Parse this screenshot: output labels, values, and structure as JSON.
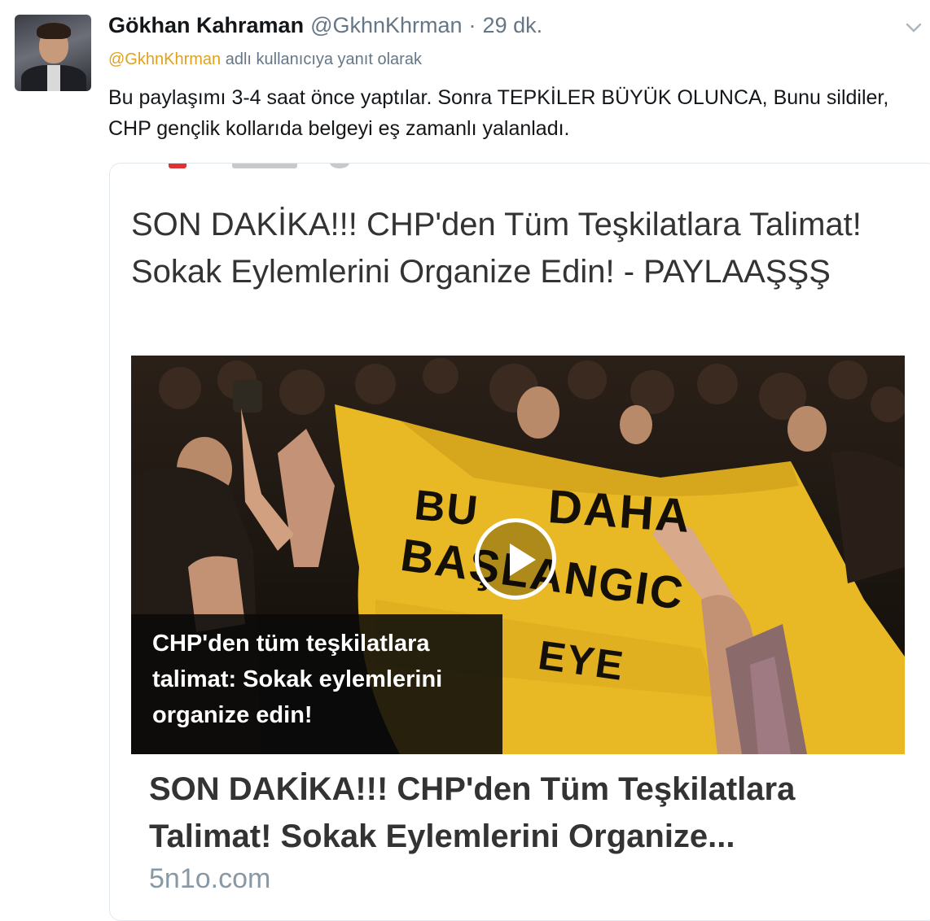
{
  "tweet": {
    "author_name": "Gökhan Kahraman",
    "author_handle": "@GkhnKhrman",
    "separator": "·",
    "time": "29 dk.",
    "reply_to_handle": "@GkhnKhrman",
    "reply_suffix": "adlı kullanıcıya yanıt olarak",
    "text": "Bu paylaşımı 3-4 saat önce yaptılar. Sonra TEPKİLER BÜYÜK OLUNCA, Bunu sildiler, CHP gençlik kollarıda belgeyi eş zamanlı yalanladı."
  },
  "card": {
    "headline": "SON DAKİKA!!! CHP'den Tüm Teşkilatlara Talimat! Sokak Eylemlerini Organize Edin! - PAYLAAŞŞŞ",
    "video_caption": "CHP'den tüm teşkilatlara talimat: Sokak eylemlerini organize edin!",
    "banner_text_1": "BU",
    "banner_text_2": "DAHA",
    "banner_text_3": "BAŞLANGIC",
    "banner_text_4": "EYE",
    "link_title": "SON DAKİKA!!! CHP'den Tüm Teşkilatlara Talimat! Sokak Eylemlerini Organize...",
    "domain": "5n1o.com"
  },
  "icons": {
    "avatar": "profile-photo",
    "menu": "chevron-down-icon",
    "play": "play-icon"
  },
  "colors": {
    "link": "#e0a21b",
    "secondary_text": "#657786",
    "banner_yellow": "#e8b825"
  }
}
